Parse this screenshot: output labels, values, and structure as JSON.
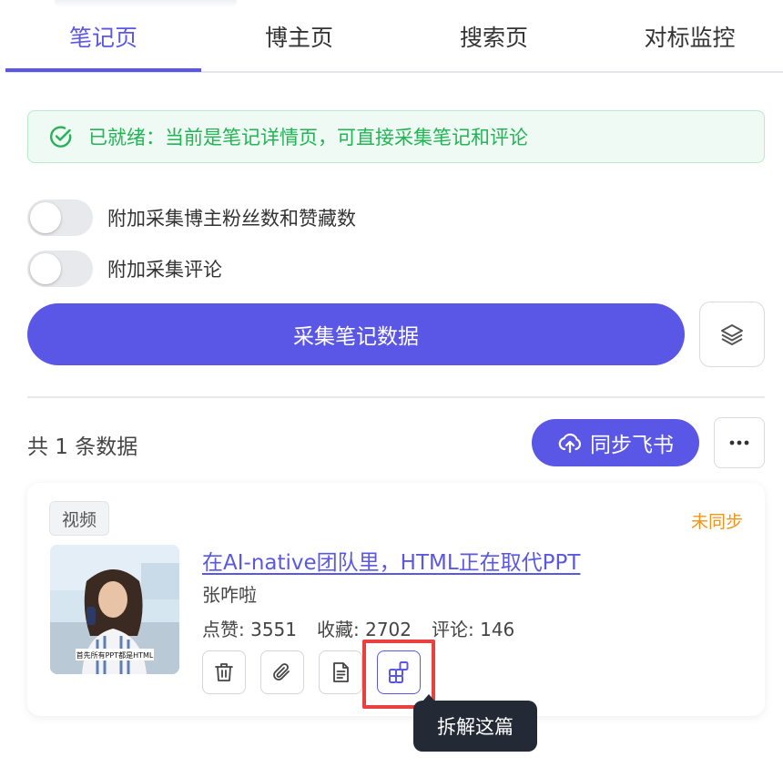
{
  "tabs": [
    {
      "label": "笔记页",
      "active": true
    },
    {
      "label": "博主页",
      "active": false
    },
    {
      "label": "搜索页",
      "active": false
    },
    {
      "label": "对标监控",
      "active": false
    }
  ],
  "status": {
    "text": "已就绪：当前是笔记详情页，可直接采集笔记和评论",
    "icon": "check-circle-icon",
    "color": "#22b455"
  },
  "options": [
    {
      "label": "附加采集博主粉丝数和赞藏数",
      "enabled": false
    },
    {
      "label": "附加采集评论",
      "enabled": false
    }
  ],
  "collect_button": {
    "label": "采集笔记数据"
  },
  "layers_button": {
    "icon": "layers-icon"
  },
  "results": {
    "count_text": "共 1 条数据",
    "sync_button": {
      "label": "同步飞书",
      "icon": "cloud-upload-icon"
    },
    "more_button": {
      "icon": "more-horizontal-icon"
    }
  },
  "card": {
    "tag": "视频",
    "sync_status": "未同步",
    "title": "在AI-native团队里，HTML正在取代PPT",
    "author": "张咋啦",
    "stats": {
      "likes": "点赞: 3551",
      "favorites": "收藏: 2702",
      "comments": "评论: 146"
    },
    "thumbnail_caption": "首先所有PPT都是HTML",
    "actions": [
      {
        "icon": "trash-icon"
      },
      {
        "icon": "paperclip-icon"
      },
      {
        "icon": "document-icon"
      },
      {
        "icon": "breakdown-icon"
      }
    ]
  },
  "tooltip": {
    "text": "拆解这篇"
  },
  "colors": {
    "accent": "#5b57e6",
    "success": "#22b455",
    "warning": "#f0941a",
    "highlight": "#e8413f"
  }
}
